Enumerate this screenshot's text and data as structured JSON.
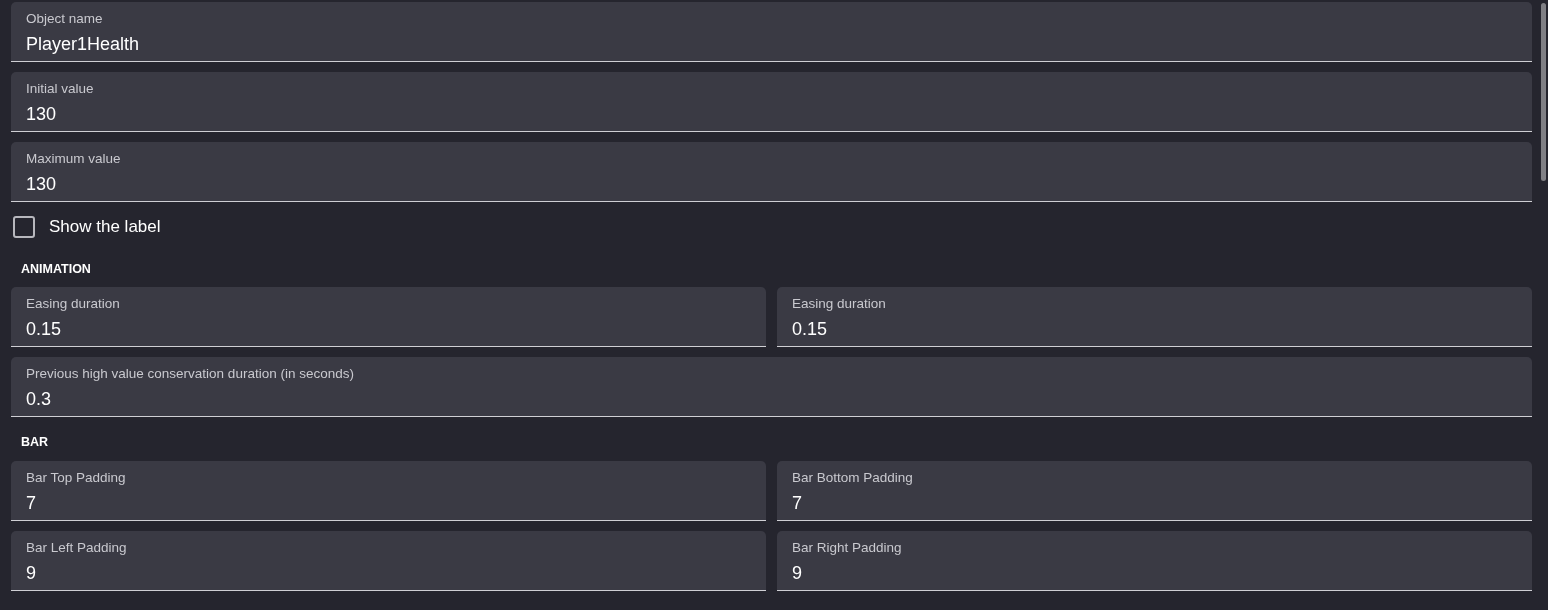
{
  "items": [
    {
      "kind": "fields",
      "fields": [
        {
          "label": "Object name",
          "value": "Player1Health"
        }
      ]
    },
    {
      "kind": "fields",
      "fields": [
        {
          "label": "Initial value",
          "value": "130"
        }
      ]
    },
    {
      "kind": "fields",
      "fields": [
        {
          "label": "Maximum value",
          "value": "130"
        }
      ]
    },
    {
      "kind": "checkbox",
      "label": "Show the label",
      "checked": false
    },
    {
      "kind": "heading",
      "text": "ANIMATION"
    },
    {
      "kind": "fields",
      "fields": [
        {
          "label": "Easing duration",
          "value": "0.15"
        },
        {
          "label": "Easing duration",
          "value": "0.15"
        }
      ]
    },
    {
      "kind": "fields",
      "fields": [
        {
          "label": "Previous high value conservation duration (in seconds)",
          "value": "0.3"
        }
      ]
    },
    {
      "kind": "heading",
      "text": "BAR"
    },
    {
      "kind": "fields",
      "fields": [
        {
          "label": "Bar Top Padding",
          "value": "7"
        },
        {
          "label": "Bar Bottom Padding",
          "value": "7"
        }
      ]
    },
    {
      "kind": "fields",
      "fields": [
        {
          "label": "Bar Left Padding",
          "value": "9"
        },
        {
          "label": "Bar Right Padding",
          "value": "9"
        }
      ]
    }
  ]
}
